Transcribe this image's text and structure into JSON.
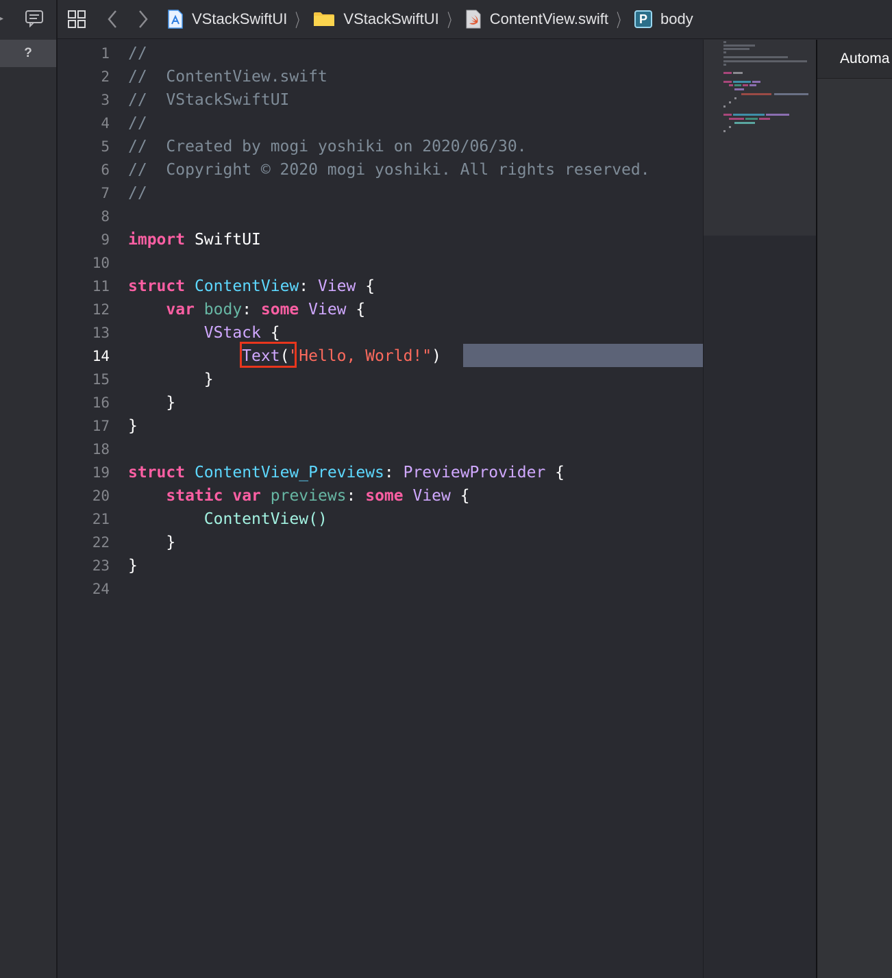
{
  "left_strip": {
    "help_label": "?"
  },
  "breadcrumb": [
    {
      "icon": "app-project-icon",
      "label": "VStackSwiftUI"
    },
    {
      "icon": "folder-icon",
      "label": "VStackSwiftUI"
    },
    {
      "icon": "swift-file-icon",
      "label": "ContentView.swift"
    },
    {
      "icon": "property-icon",
      "icon_letter": "P",
      "label": "body"
    }
  ],
  "gutter": {
    "current_line": 14,
    "numbers": [
      "1",
      "2",
      "3",
      "4",
      "5",
      "6",
      "7",
      "8",
      "9",
      "10",
      "11",
      "12",
      "13",
      "14",
      "15",
      "16",
      "17",
      "18",
      "19",
      "20",
      "21",
      "22",
      "23",
      "24"
    ]
  },
  "code": {
    "l1": "//",
    "l2": "//  ContentView.swift",
    "l3": "//  VStackSwiftUI",
    "l4": "//",
    "l5": "//  Created by mogi yoshiki on 2020/06/30.",
    "l6": "//  Copyright © 2020 mogi yoshiki. All rights reserved.",
    "l7": "//",
    "kw_import": "import",
    "mod_swiftui": "SwiftUI",
    "kw_struct": "struct",
    "contentview": "ContentView",
    "view": "View",
    "kw_var": "var",
    "body": "body",
    "kw_some": "some",
    "vstack": "VStack",
    "text": "Text",
    "hello": "\"Hello, World!\"",
    "previews_struct": "ContentView_Previews",
    "preview_provider": "PreviewProvider",
    "kw_static": "static",
    "previews": "previews",
    "contentview_call": "ContentView()"
  },
  "right_panel": {
    "header": "Automa"
  },
  "colors": {
    "keyword": "#fc5fa3",
    "type_decl": "#5dd8ff",
    "type_ref": "#d0a8ff",
    "property": "#67b7a4",
    "string": "#fc6a5d",
    "comment": "#7f8c98",
    "annotation_box": "#e8361d"
  }
}
